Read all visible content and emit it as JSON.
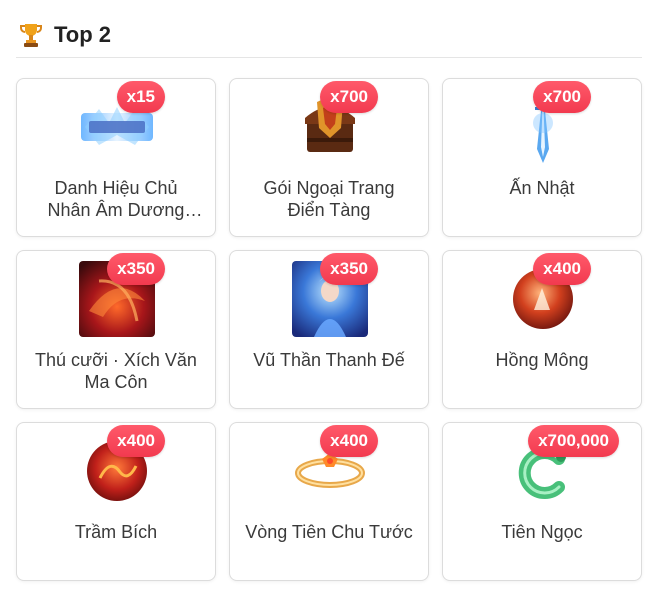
{
  "header": {
    "title": "Top 2",
    "icon": "trophy-icon"
  },
  "items": [
    {
      "name": "Danh Hiệu Chủ Nhân Âm Dương Đạo",
      "qty": "x15",
      "icon": "title-banner-icon"
    },
    {
      "name": "Gói Ngoại Trang Điển Tàng",
      "qty": "x700",
      "icon": "treasure-chest-icon"
    },
    {
      "name": "Ấn Nhật",
      "qty": "x700",
      "icon": "sword-effect-icon"
    },
    {
      "name": "Thú cưỡi · Xích Văn Ma Côn",
      "qty": "x350",
      "icon": "red-vortex-icon"
    },
    {
      "name": "Vũ Thần Thanh Đế",
      "qty": "x350",
      "icon": "blue-goddess-icon"
    },
    {
      "name": "Hồng Mông",
      "qty": "x400",
      "icon": "red-orb-icon"
    },
    {
      "name": "Trầm Bích",
      "qty": "x400",
      "icon": "red-dragon-orb-icon"
    },
    {
      "name": "Vòng Tiên Chu Tước",
      "qty": "x400",
      "icon": "ring-icon"
    },
    {
      "name": "Tiên Ngọc",
      "qty": "x700,000",
      "icon": "green-jade-icon"
    }
  ],
  "colors": {
    "badge": "#f23a4f",
    "border": "#dcdcdc"
  }
}
